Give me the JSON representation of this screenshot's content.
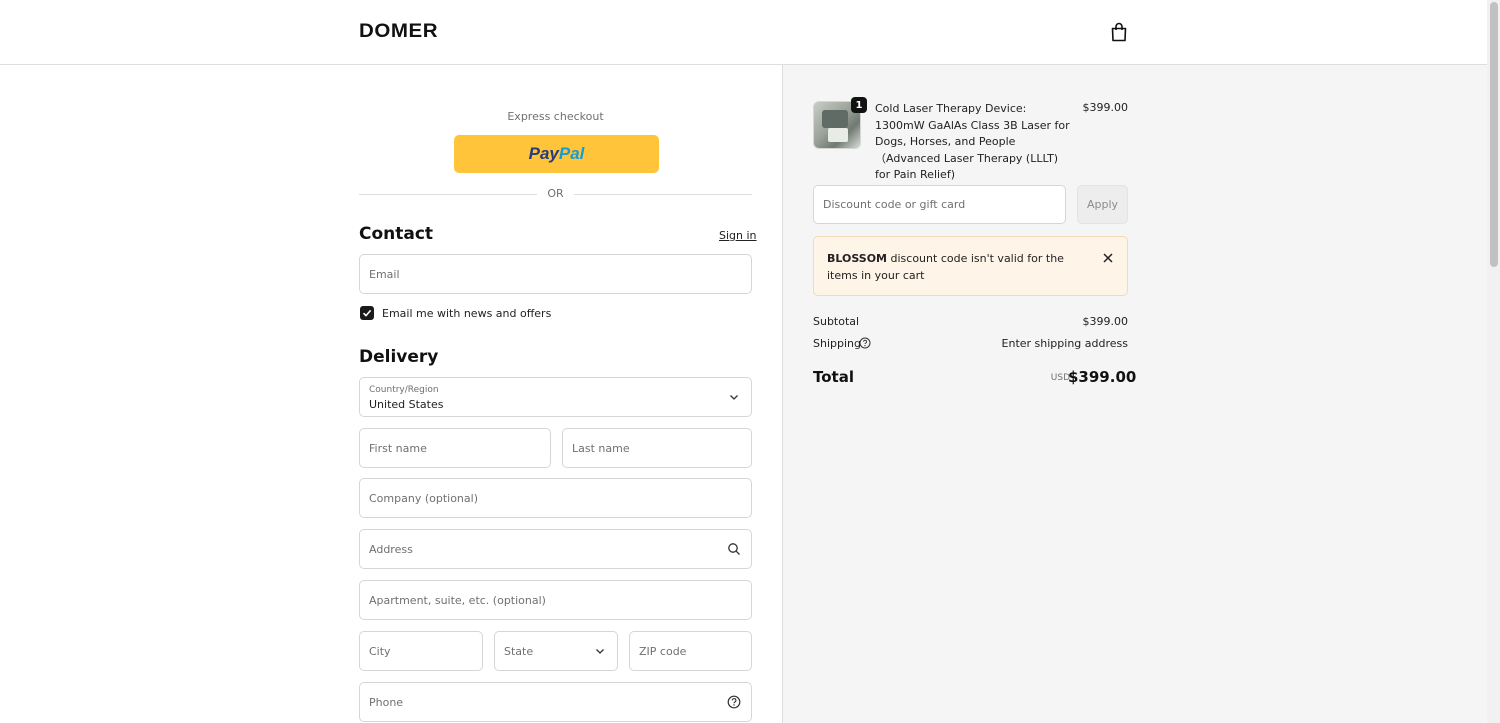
{
  "header": {
    "logo": "DOMER",
    "cart_icon": "shopping-bag-icon"
  },
  "express": {
    "label": "Express checkout",
    "paypal_part1": "Pay",
    "paypal_part2": "Pal",
    "separator": "OR"
  },
  "contact": {
    "title": "Contact",
    "sign_in": "Sign in",
    "email_placeholder": "Email",
    "newsletter_label": "Email me with news and offers",
    "newsletter_checked": true
  },
  "delivery": {
    "title": "Delivery",
    "country_label": "Country/Region",
    "country_value": "United States",
    "first_name_placeholder": "First name",
    "last_name_placeholder": "Last name",
    "company_placeholder": "Company (optional)",
    "address_placeholder": "Address",
    "apartment_placeholder": "Apartment, suite, etc. (optional)",
    "city_placeholder": "City",
    "state_placeholder": "State",
    "zip_placeholder": "ZIP code",
    "phone_placeholder": "Phone"
  },
  "order": {
    "item": {
      "name": "Cold Laser Therapy Device: 1300mW GaAlAs Class 3B Laser for Dogs, Horses, and People（Advanced Laser Therapy (LLLT) for Pain Relief)",
      "price": "$399.00",
      "quantity": "1"
    },
    "discount_placeholder": "Discount code or gift card",
    "apply_label": "Apply",
    "alert": {
      "code": "BLOSSOM",
      "message": " discount code isn't valid for the items in your cart"
    },
    "subtotal_label": "Subtotal",
    "subtotal_value": "$399.00",
    "shipping_label": "Shipping",
    "shipping_value": "Enter shipping address",
    "total_label": "Total",
    "total_currency": "USD",
    "total_value": "$399.00"
  },
  "colors": {
    "paypal_yellow": "#ffc439",
    "paypal_dark_blue": "#253b80",
    "paypal_light_blue": "#179bd7",
    "alert_bg": "#fff4e8",
    "panel_bg": "#f5f5f5"
  }
}
